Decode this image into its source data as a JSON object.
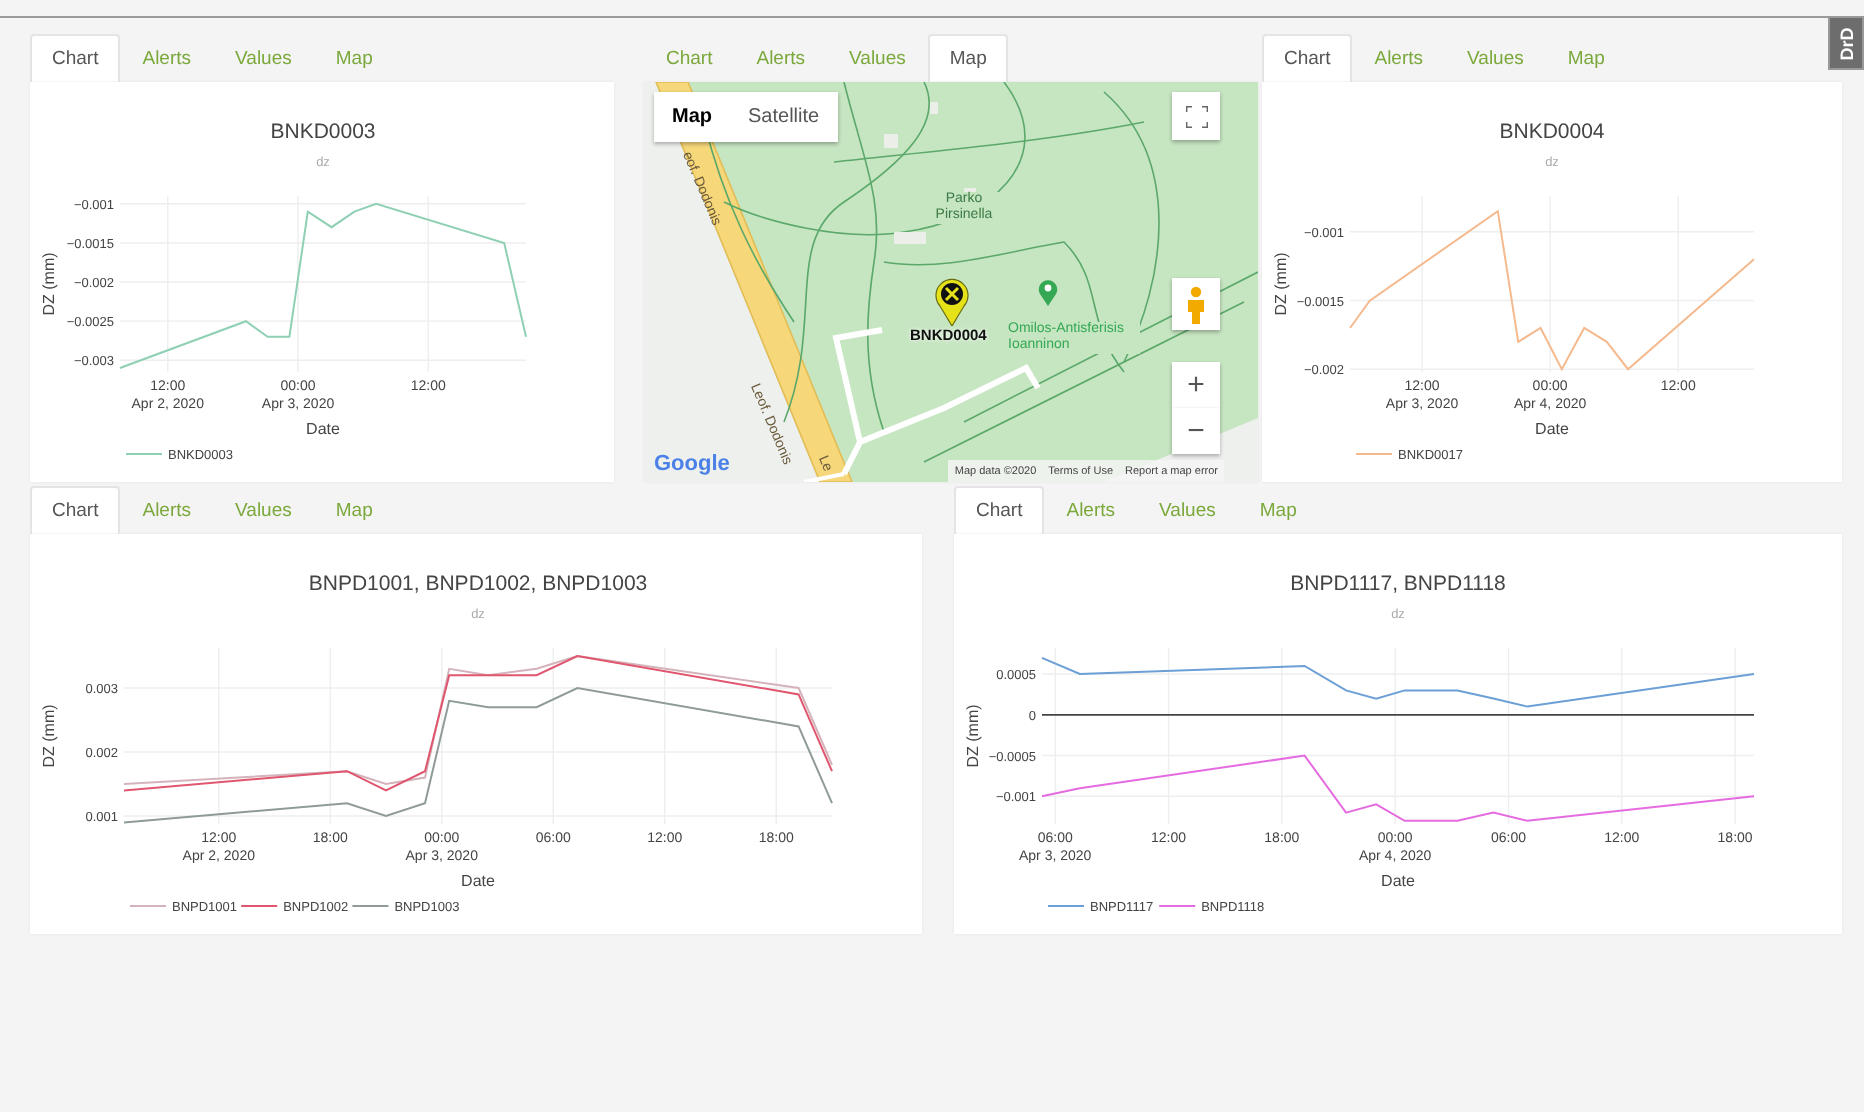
{
  "side_tab": "DrD",
  "panels": [
    {
      "kind": "chart",
      "tabs": [
        {
          "label": "Chart",
          "selected": true
        },
        {
          "label": "Alerts",
          "selected": false
        },
        {
          "label": "Values",
          "selected": false
        },
        {
          "label": "Map",
          "selected": false
        }
      ],
      "chart": {
        "subtitle": "dz",
        "chart_data": {
          "type": "line",
          "title": "BNKD0003",
          "xlabel": "Date",
          "ylabel": "DZ (mm)",
          "grid": true,
          "legend": true,
          "x": [
            "2020-04-02T07:36",
            "2020-04-02T19:12",
            "2020-04-02T21:12",
            "2020-04-02T23:12",
            "2020-04-03T00:54",
            "2020-04-03T03:06",
            "2020-04-03T05:12",
            "2020-04-03T07:12",
            "2020-04-03T19:00",
            "2020-04-03T21:00"
          ],
          "series": [
            {
              "name": "BNKD0003",
              "color": "#8fd0b4",
              "values": [
                -0.0031,
                -0.0025,
                -0.0027,
                -0.0027,
                -0.0011,
                -0.0013,
                -0.0011,
                -0.001,
                -0.0015,
                -0.0027
              ]
            }
          ],
          "xlim": [
            "2020-04-02T07:36",
            "2020-04-03T21:00"
          ],
          "ylim": [
            -0.00315,
            -0.0009
          ],
          "xticks": [
            {
              "value": "2020-04-02T12:00",
              "label": "12:00\nApr 2, 2020"
            },
            {
              "value": "2020-04-03T00:00",
              "label": "00:00\nApr 3, 2020"
            },
            {
              "value": "2020-04-03T12:00",
              "label": "12:00"
            }
          ],
          "yticks": [
            {
              "value": -0.001,
              "label": "−0.001"
            },
            {
              "value": -0.0015,
              "label": "−0.0015"
            },
            {
              "value": -0.002,
              "label": "−0.002"
            },
            {
              "value": -0.0025,
              "label": "−0.0025"
            },
            {
              "value": -0.003,
              "label": "−0.003"
            }
          ]
        }
      }
    },
    {
      "kind": "map",
      "tabs": [
        {
          "label": "Chart",
          "selected": false
        },
        {
          "label": "Alerts",
          "selected": false
        },
        {
          "label": "Values",
          "selected": false
        },
        {
          "label": "Map",
          "selected": true
        }
      ],
      "map": {
        "view_buttons": [
          {
            "label": "Map",
            "selected": true
          },
          {
            "label": "Satellite",
            "selected": false
          }
        ],
        "place_label": "Parko Pirsinella",
        "road_labels": [
          "eof. Dodonis",
          "Leof. Dodonis",
          "Le"
        ],
        "marker_label": "BNKD0004",
        "poi_label": "Omilos-Antisferisis Ioanninon",
        "zoom_in": "+",
        "zoom_out": "−",
        "logo": "Google",
        "footer": [
          "Map data ©2020",
          "Terms of Use",
          "Report a map error"
        ]
      }
    },
    {
      "kind": "chart",
      "tabs": [
        {
          "label": "Chart",
          "selected": true
        },
        {
          "label": "Alerts",
          "selected": false
        },
        {
          "label": "Values",
          "selected": false
        },
        {
          "label": "Map",
          "selected": false
        }
      ],
      "chart": {
        "subtitle": "dz",
        "chart_data": {
          "type": "line",
          "title": "BNKD0004",
          "xlabel": "Date",
          "ylabel": "DZ (mm)",
          "grid": true,
          "legend": true,
          "x": [
            "2020-04-03T05:15",
            "2020-04-03T07:06",
            "2020-04-03T19:06",
            "2020-04-03T21:00",
            "2020-04-03T23:06",
            "2020-04-04T01:06",
            "2020-04-04T03:12",
            "2020-04-04T05:18",
            "2020-04-04T07:18",
            "2020-04-04T19:06"
          ],
          "series": [
            {
              "name": "BNKD0017",
              "color": "#f5b98e",
              "values": [
                -0.0017,
                -0.0015,
                -0.00085,
                -0.0018,
                -0.0017,
                -0.002,
                -0.0017,
                -0.0018,
                -0.002,
                -0.0012
              ]
            }
          ],
          "xlim": [
            "2020-04-03T05:15",
            "2020-04-04T19:06"
          ],
          "ylim": [
            -0.00202,
            -0.00074
          ],
          "xticks": [
            {
              "value": "2020-04-03T12:00",
              "label": "12:00\nApr 3, 2020"
            },
            {
              "value": "2020-04-04T00:00",
              "label": "00:00\nApr 4, 2020"
            },
            {
              "value": "2020-04-04T12:00",
              "label": "12:00"
            }
          ],
          "yticks": [
            {
              "value": -0.001,
              "label": "−0.001"
            },
            {
              "value": -0.0015,
              "label": "−0.0015"
            },
            {
              "value": -0.002,
              "label": "−0.002"
            }
          ]
        }
      }
    },
    {
      "kind": "chart",
      "tabs": [
        {
          "label": "Chart",
          "selected": true
        },
        {
          "label": "Alerts",
          "selected": false
        },
        {
          "label": "Values",
          "selected": false
        },
        {
          "label": "Map",
          "selected": false
        }
      ],
      "chart": {
        "subtitle": "dz",
        "chart_data": {
          "type": "line",
          "title": "BNPD1001, BNPD1002, BNPD1003",
          "xlabel": "Date",
          "ylabel": "DZ (mm)",
          "grid": true,
          "legend": true,
          "x": [
            "2020-04-02T06:54",
            "2020-04-02T18:54",
            "2020-04-02T21:00",
            "2020-04-02T23:06",
            "2020-04-03T00:24",
            "2020-04-03T02:30",
            "2020-04-03T05:06",
            "2020-04-03T07:18",
            "2020-04-03T19:12",
            "2020-04-03T21:00"
          ],
          "series": [
            {
              "name": "BNPD1001",
              "color": "#d4b3bb",
              "values": [
                0.0015,
                0.0017,
                0.0015,
                0.0016,
                0.0033,
                0.0032,
                0.0033,
                0.0035,
                0.003,
                0.0018
              ]
            },
            {
              "name": "BNPD1002",
              "color": "#e0566f",
              "values": [
                0.0014,
                0.0017,
                0.0014,
                0.0017,
                0.0032,
                0.0032,
                0.0032,
                0.0035,
                0.0029,
                0.0017
              ]
            },
            {
              "name": "BNPD1003",
              "color": "#8e9b98",
              "values": [
                0.0009,
                0.0012,
                0.001,
                0.0012,
                0.0028,
                0.0027,
                0.0027,
                0.003,
                0.0024,
                0.0012
              ]
            }
          ],
          "xlim": [
            "2020-04-02T06:54",
            "2020-04-03T21:00"
          ],
          "ylim": [
            0.000875,
            0.003625
          ],
          "xticks": [
            {
              "value": "2020-04-02T12:00",
              "label": "12:00\nApr 2, 2020"
            },
            {
              "value": "2020-04-02T18:00",
              "label": "18:00"
            },
            {
              "value": "2020-04-03T00:00",
              "label": "00:00\nApr 3, 2020"
            },
            {
              "value": "2020-04-03T06:00",
              "label": "06:00"
            },
            {
              "value": "2020-04-03T12:00",
              "label": "12:00"
            },
            {
              "value": "2020-04-03T18:00",
              "label": "18:00"
            }
          ],
          "yticks": [
            {
              "value": 0.001,
              "label": "0.001"
            },
            {
              "value": 0.002,
              "label": "0.002"
            },
            {
              "value": 0.003,
              "label": "0.003"
            }
          ]
        }
      }
    },
    {
      "kind": "chart",
      "tabs": [
        {
          "label": "Chart",
          "selected": true
        },
        {
          "label": "Alerts",
          "selected": false
        },
        {
          "label": "Values",
          "selected": false
        },
        {
          "label": "Map",
          "selected": false
        }
      ],
      "chart": {
        "subtitle": "dz",
        "chart_data": {
          "type": "line",
          "title": "BNPD1117, BNPD1118",
          "xlabel": "Date",
          "ylabel": "DZ (mm)",
          "grid": true,
          "legend": true,
          "x": [
            "2020-04-03T05:18",
            "2020-04-03T07:18",
            "2020-04-03T19:12",
            "2020-04-03T21:24",
            "2020-04-03T23:00",
            "2020-04-04T00:30",
            "2020-04-04T03:18",
            "2020-04-04T05:12",
            "2020-04-04T07:00",
            "2020-04-04T19:00"
          ],
          "series": [
            {
              "name": "BNPD1117",
              "color": "#6b9fd6",
              "values": [
                0.0007,
                0.0005,
                0.0006,
                0.0003,
                0.0002,
                0.0003,
                0.0003,
                0.0002,
                0.0001,
                0.0005
              ]
            },
            {
              "name": "BNPD1118",
              "color": "#e56be0",
              "values": [
                -0.001,
                -0.0009,
                -0.0005,
                -0.0012,
                -0.0011,
                -0.0013,
                -0.0013,
                -0.0012,
                -0.0013,
                -0.001
              ]
            }
          ],
          "xlim": [
            "2020-04-03T05:18",
            "2020-04-04T19:00"
          ],
          "ylim": [
            -0.00134,
            0.00082
          ],
          "xticks": [
            {
              "value": "2020-04-03T06:00",
              "label": "06:00\nApr 3, 2020"
            },
            {
              "value": "2020-04-03T12:00",
              "label": "12:00"
            },
            {
              "value": "2020-04-03T18:00",
              "label": "18:00"
            },
            {
              "value": "2020-04-04T00:00",
              "label": "00:00\nApr 4, 2020"
            },
            {
              "value": "2020-04-04T06:00",
              "label": "06:00"
            },
            {
              "value": "2020-04-04T12:00",
              "label": "12:00"
            },
            {
              "value": "2020-04-04T18:00",
              "label": "18:00"
            }
          ],
          "yticks": [
            {
              "value": 0.0005,
              "label": "0.0005"
            },
            {
              "value": 0,
              "label": "0"
            },
            {
              "value": -0.0005,
              "label": "−0.0005"
            },
            {
              "value": -0.001,
              "label": "−0.001"
            }
          ]
        }
      }
    }
  ]
}
